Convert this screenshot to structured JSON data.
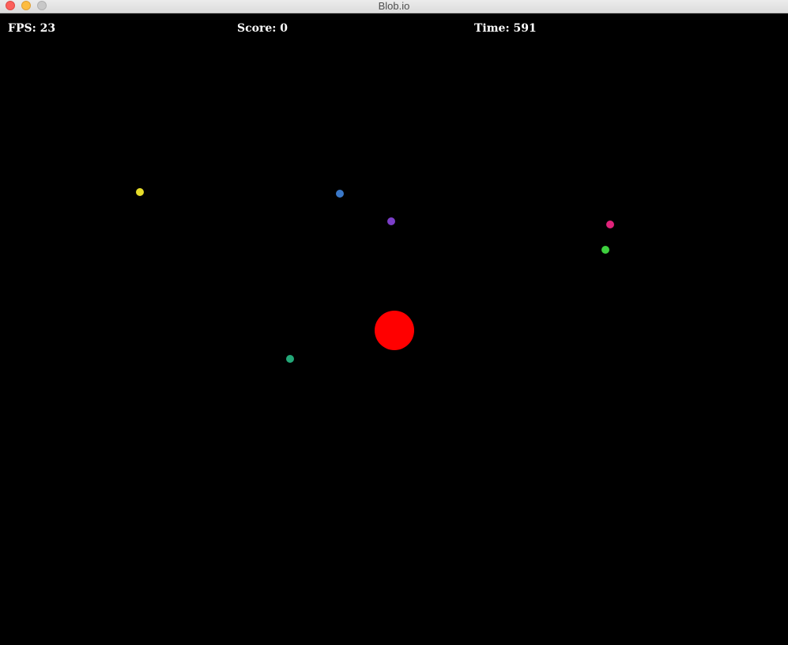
{
  "window": {
    "title": "Blob.io",
    "controls": [
      "close",
      "minimize",
      "zoom"
    ]
  },
  "hud": {
    "fps": "FPS: 23",
    "score": "Score: 0",
    "time": "Time: 591"
  },
  "entities": {
    "player": {
      "color": "#ff0000"
    },
    "pellets": [
      {
        "color": "#e6dc2a"
      },
      {
        "color": "#3a78c8"
      },
      {
        "color": "#7b3ec8"
      },
      {
        "color": "#e0237a"
      },
      {
        "color": "#3ed03e"
      },
      {
        "color": "#23a878"
      }
    ]
  },
  "colors": {
    "background": "#000000",
    "hud_text": "#ffffff"
  }
}
